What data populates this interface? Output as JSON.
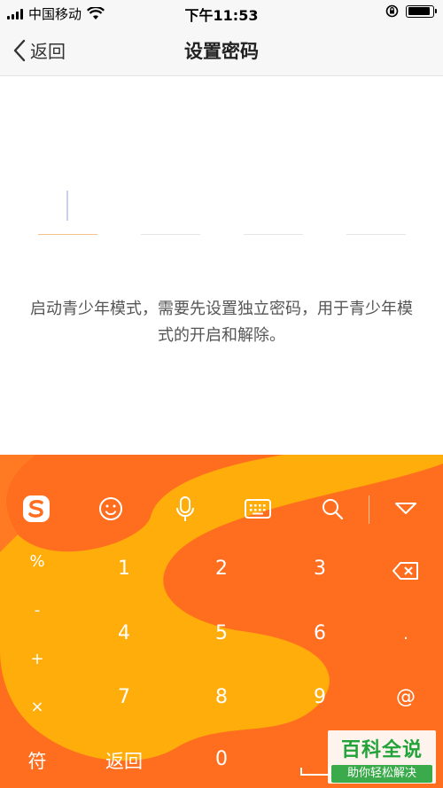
{
  "status_bar": {
    "carrier": "中国移动",
    "time": "下午11:53",
    "battery_level": 0.9
  },
  "nav": {
    "back_label": "返回",
    "title": "设置密码"
  },
  "password": {
    "slots": 4,
    "hint": "启动青少年模式，需要先设置独立密码，用于青少年模式的开启和解除。"
  },
  "keyboard": {
    "toolbar_icons": [
      "sogou-logo-icon",
      "emoji-icon",
      "microphone-icon",
      "keyboard-icon",
      "search-icon",
      "collapse-keyboard-icon"
    ],
    "symbols": [
      "%",
      "-",
      "+",
      "×"
    ],
    "digits": [
      "1",
      "2",
      "3",
      "4",
      "5",
      "6",
      "7",
      "8",
      "9",
      "0"
    ],
    "dot": ".",
    "at": "@",
    "symbol_key": "符",
    "return_key": "返回"
  },
  "watermark": {
    "title": "百科全说",
    "subtitle": "助你轻松解决"
  },
  "colors": {
    "keyboard_orange": "#ff6e1f",
    "keyboard_yellow": "#ffad0a",
    "active_underline": "#f5c28a"
  }
}
